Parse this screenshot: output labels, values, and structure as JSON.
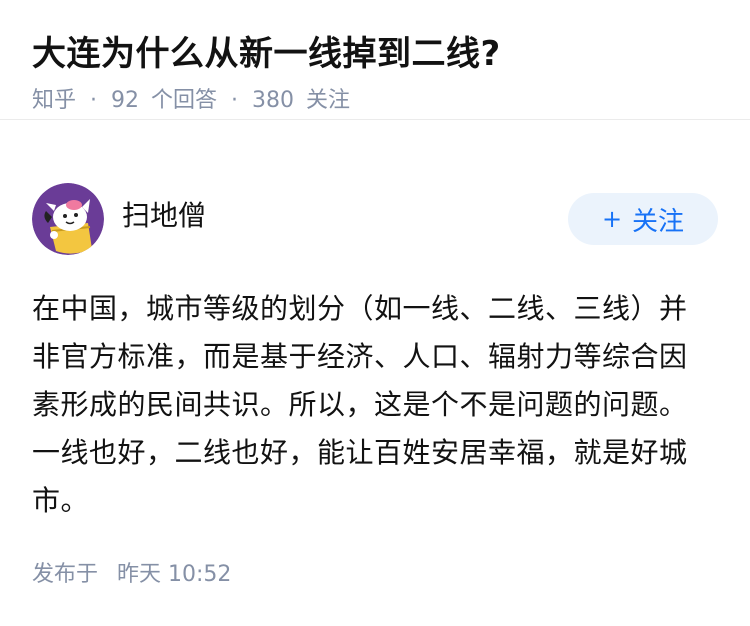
{
  "question": {
    "title": "大连为什么从新一线掉到二线?",
    "source": "知乎",
    "answer_count": "92",
    "answer_label": "个回答",
    "follower_count": "380",
    "follower_label": "关注"
  },
  "answer": {
    "author_name": "扫地僧",
    "follow_plus": "+",
    "follow_label": "关注",
    "content": "在中国，城市等级的划分（如一线、二线、三线）并非官方标准，而是基于经济、人口、辐射力等综合因素形成的民间共识。所以，这是个不是问题的问题。一线也好，二线也好，能让百姓安居幸福，就是好城市。",
    "published_label": "发布于",
    "published_time": "昨天 10:52"
  },
  "colors": {
    "text": "#121212",
    "meta": "#8590a6",
    "follow_bg": "#ebf3fc",
    "follow_text": "#1772f6",
    "avatar_bg": "#6a3c97"
  },
  "icons": {
    "avatar": "cartoon-avatar"
  }
}
